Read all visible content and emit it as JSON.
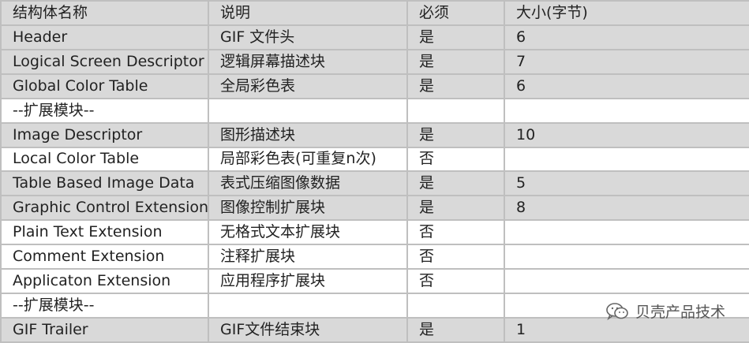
{
  "table": {
    "header": [
      "结构体名称",
      "说明",
      "必须",
      "大小(字节)"
    ],
    "rows": [
      {
        "name": "Header",
        "desc": "GIF 文件头",
        "required": "是",
        "size": "6"
      },
      {
        "name": "Logical Screen Descriptor",
        "desc": "逻辑屏幕描述块",
        "required": "是",
        "size": "7"
      },
      {
        "name": "Global Color Table",
        "desc": "全局彩色表",
        "required": "是",
        "size": "6"
      },
      {
        "name": "--扩展模块--",
        "desc": "",
        "required": "",
        "size": ""
      },
      {
        "name": "Image Descriptor",
        "desc": "图形描述块",
        "required": "是",
        "size": "10"
      },
      {
        "name": "Local Color Table",
        "desc": "局部彩色表(可重复n次)",
        "required": "否",
        "size": ""
      },
      {
        "name": "Table Based Image Data",
        "desc": "表式压缩图像数据",
        "required": "是",
        "size": "5"
      },
      {
        "name": "Graphic Control Extension",
        "desc": "图像控制扩展块",
        "required": "是",
        "size": "8"
      },
      {
        "name": "Plain Text Extension",
        "desc": "无格式文本扩展块",
        "required": "否",
        "size": ""
      },
      {
        "name": "Comment Extension",
        "desc": "注释扩展块",
        "required": "否",
        "size": ""
      },
      {
        "name": "Applicaton Extension",
        "desc": "应用程序扩展块",
        "required": "否",
        "size": ""
      },
      {
        "name": "--扩展模块--",
        "desc": "",
        "required": "",
        "size": ""
      },
      {
        "name": "GIF Trailer",
        "desc": "GIF文件结束块",
        "required": "是",
        "size": "1"
      }
    ]
  },
  "watermark": {
    "text": "贝壳产品技术",
    "icon": "wechat-icon"
  },
  "colors": {
    "shaded_row": "#d9d9d9",
    "plain_row": "#ffffff",
    "border": "#bfbfbf",
    "text": "#222222"
  }
}
